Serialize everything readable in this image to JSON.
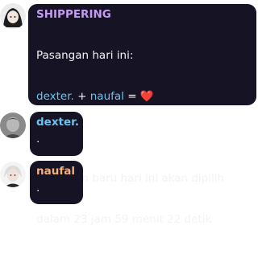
{
  "messages": [
    {
      "author": "SHIPPERING",
      "author_color": "#c59cf2",
      "avatar_icon": "anime-girl-avatar",
      "line1": "Pasangan hari ini:",
      "pair_name1": "dexter.",
      "pair_plus": " + ",
      "pair_name2": "naufal",
      "pair_equals": " = ",
      "heart": "❤️",
      "line3": "Pasangan baru hari ini akan dipilih",
      "line4": "dalam 23 jam 59 menit 22 detik"
    },
    {
      "author": "dexter.",
      "author_color": "#6cc3ee",
      "avatar_icon": "grey-character-avatar",
      "text": "."
    },
    {
      "author": "naufal",
      "author_color": "#f4b07f",
      "avatar_icon": "white-haired-character-avatar",
      "text": "."
    }
  ],
  "colors": {
    "bubble_bg": "#161325",
    "text": "#f3f3f7",
    "mention": "#6cc3ee",
    "heart": "#e8344e"
  }
}
